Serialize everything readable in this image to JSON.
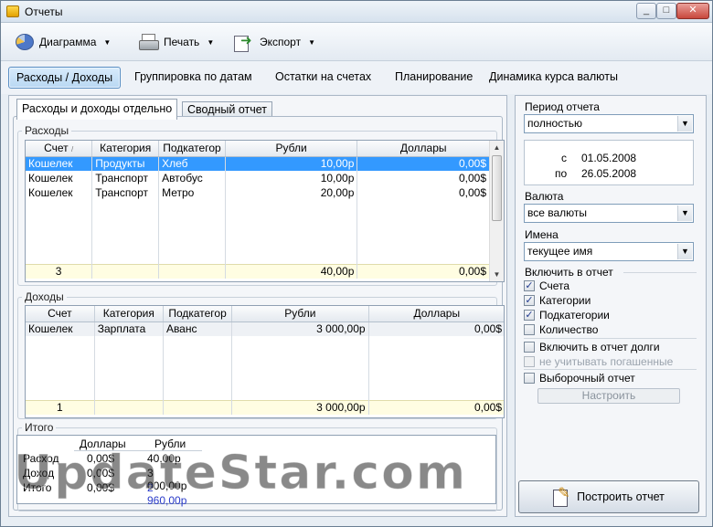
{
  "window": {
    "title": "Отчеты",
    "min": "_",
    "max": "□",
    "close": "✕"
  },
  "toolbar": {
    "diagram": "Диаграмма",
    "print": "Печать",
    "export": "Экспорт",
    "arrow": "▼"
  },
  "tabs": [
    "Расходы / Доходы",
    "Группировка по датам",
    "Остатки на счетах",
    "Планирование",
    "Динамика курса валюты"
  ],
  "subtabs": [
    "Расходы и доходы отдельно",
    "Сводный отчет"
  ],
  "expenses": {
    "title": "Расходы",
    "columns": [
      "Счет",
      "Категория",
      "Подкатегор",
      "Рубли",
      "Доллары"
    ],
    "sort_mark": "/",
    "rows": [
      [
        "Кошелек",
        "Продукты",
        "Хлеб",
        "10,00р",
        "0,00$"
      ],
      [
        "Кошелек",
        "Транспорт",
        "Автобус",
        "10,00р",
        "0,00$"
      ],
      [
        "Кошелек",
        "Транспорт",
        "Метро",
        "20,00р",
        "0,00$"
      ]
    ],
    "footer": [
      "3",
      "",
      "",
      "40,00р",
      "0,00$"
    ]
  },
  "income": {
    "title": "Доходы",
    "columns": [
      "Счет",
      "Категория",
      "Подкатегор",
      "Рубли",
      "Доллары"
    ],
    "rows": [
      [
        "Кошелек",
        "Зарплата",
        "Аванс",
        "3 000,00р",
        "0,00$"
      ]
    ],
    "footer": [
      "1",
      "",
      "",
      "3 000,00р",
      "0,00$"
    ]
  },
  "totals": {
    "title": "Итого",
    "header": [
      "",
      "Доллары",
      "Рубли"
    ],
    "rows": [
      [
        "Расход",
        "0,00$",
        "40,00р"
      ],
      [
        "Доход",
        "0,00$",
        "3 000,00р"
      ],
      [
        "Итого",
        "0,00$",
        "2 960,00р"
      ]
    ]
  },
  "watermark": "UpdateStar.com",
  "side": {
    "period_label": "Период отчета",
    "period_value": "полностью",
    "from_label": "с",
    "from_date": "01.05.2008",
    "to_label": "по",
    "to_date": "26.05.2008",
    "currency_label": "Валюта",
    "currency_value": "все валюты",
    "names_label": "Имена",
    "names_value": "текущее имя",
    "include_label": "Включить в отчет",
    "checks": [
      {
        "label": "Счета",
        "checked": "✓"
      },
      {
        "label": "Категории",
        "checked": "✓"
      },
      {
        "label": "Подкатегории",
        "checked": "✓"
      },
      {
        "label": "Количество",
        "checked": ""
      }
    ],
    "debts_label": "Включить в отчет долги",
    "ignore_paid_label": "не учитывать погашенные",
    "selective_label": "Выборочный отчет",
    "setup_button": "Настроить",
    "build_button": "Построить отчет",
    "dropdown_arrow": "▼"
  }
}
